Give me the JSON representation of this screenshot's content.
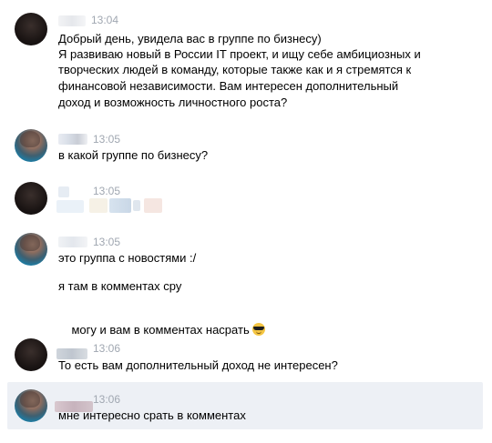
{
  "colors": {
    "time": "#a0a7b1",
    "highlight": "#edf0f5",
    "text": "#000000"
  },
  "messages": [
    {
      "time": "13:04",
      "lines": [
        "Добрый день, увидела вас в группе по бизнесу)",
        "Я развиваю новый в России IT проект, и ищу себе амбициозных и",
        "творческих людей в команду, которые также как и я стремятся к",
        "финансовой независимости. Вам интересен дополнительный",
        "доход и возможность личностного роста?"
      ]
    },
    {
      "time": "13:05",
      "lines": [
        "в какой группе по бизнесу?"
      ]
    },
    {
      "time": "13:05"
    },
    {
      "time": "13:05",
      "line1": "это группа с новостями :/",
      "line2": "я там в комментах сру",
      "line3": "могу и вам в комментах насрать",
      "emoji": "sunglasses-emoji"
    },
    {
      "time": "13:06",
      "lines": [
        "То есть вам дополнительный доход не интересен?"
      ]
    },
    {
      "time": "13:06",
      "lines": [
        "мне интересно срать в комментах"
      ]
    }
  ]
}
